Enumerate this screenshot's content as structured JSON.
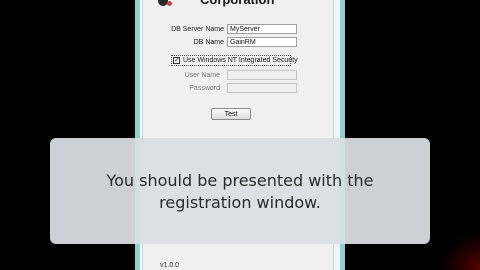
{
  "window": {
    "title": "Corporation"
  },
  "form": {
    "db_server_label": "DB Server Name",
    "db_server_value": "MyServer",
    "db_name_label": "DB Name",
    "db_name_value": "GainRM",
    "use_windows_auth_label": "Use Windows NT Integrated Security",
    "use_windows_auth_checked": true,
    "user_name_label": "User Name",
    "user_name_value": "",
    "password_label": "Password",
    "password_value": "",
    "test_button_label": "Test"
  },
  "footer": {
    "version": "v1.0.0"
  },
  "caption": {
    "line1": "You should be presented with the",
    "line2": "registration window."
  },
  "colors": {
    "window_bg": "#f0f0f0",
    "accent_strip": "#8fd0d2",
    "overlay_bg": "#dadee2",
    "caption_text": "#2a2a2a"
  },
  "icons": {
    "checkbox_mark": "check-icon"
  }
}
